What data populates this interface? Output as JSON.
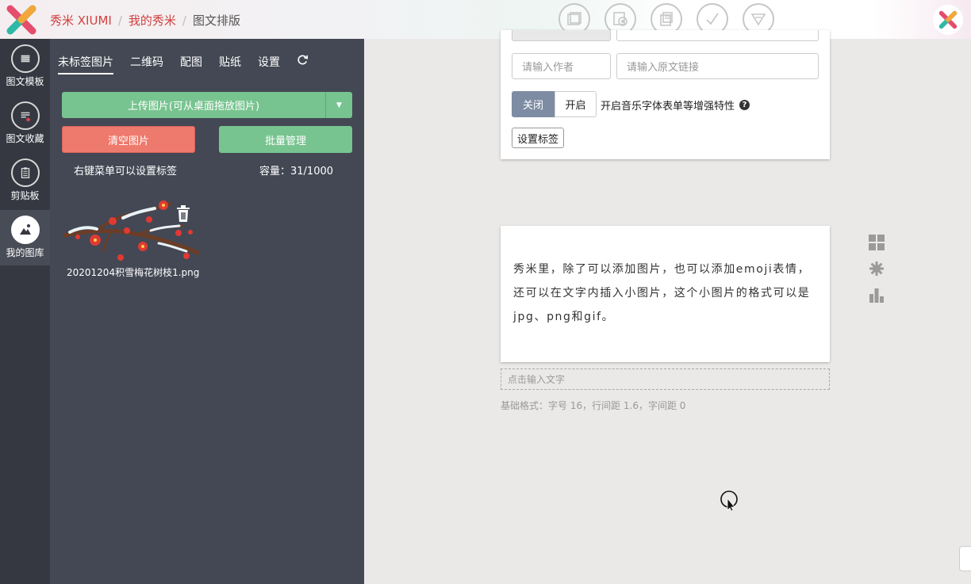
{
  "header": {
    "brand": "秀米 XIUMI",
    "crumb_mine": "我的秀米",
    "crumb_current": "图文排版",
    "separator": "/",
    "toolbar_icons": [
      "folder-icon",
      "save-preview-icon",
      "copy-icon",
      "check-icon",
      "dropdown-triangle-icon"
    ]
  },
  "nav": {
    "items": [
      {
        "label": "图文模板",
        "icon": "list-icon"
      },
      {
        "label": "图文收藏",
        "icon": "favorite-list-icon"
      },
      {
        "label": "剪贴板",
        "icon": "clipboard-icon"
      },
      {
        "label": "我的图库",
        "icon": "gallery-icon",
        "active": true
      }
    ]
  },
  "panel": {
    "tabs": [
      {
        "label": "未标签图片",
        "active": true
      },
      {
        "label": "二维码"
      },
      {
        "label": "配图"
      },
      {
        "label": "贴纸"
      },
      {
        "label": "设置"
      }
    ],
    "upload_label": "上传图片(可从桌面拖放图片)",
    "clear_label": "清空图片",
    "batch_label": "批量管理",
    "hint": "右键菜单可以设置标签",
    "capacity": "容量：31/1000",
    "image_name": "20201204积雪梅花树枝1.png"
  },
  "card1": {
    "author_placeholder": "请输入作者",
    "link_placeholder": "请输入原文链接",
    "toggle_off": "关闭",
    "toggle_on": "开启",
    "toggle_label": "开启音乐字体表单等增强特性",
    "help": "?",
    "tag_button": "设置标签"
  },
  "card2": {
    "text": "秀米里，除了可以添加图片，也可以添加emoji表情，还可以在文字内插入小图片，这个小图片的格式可以是jpg、png和gif。"
  },
  "editor": {
    "input_placeholder": "点击输入文字",
    "format_info": "基础格式：字号 16，行间距 1.6，字间距 0"
  },
  "colors": {
    "brand_red": "#d2403f",
    "green": "#78c490",
    "red_button": "#ee7a6d",
    "panel_bg": "#434854",
    "nav_bg": "#353841"
  }
}
